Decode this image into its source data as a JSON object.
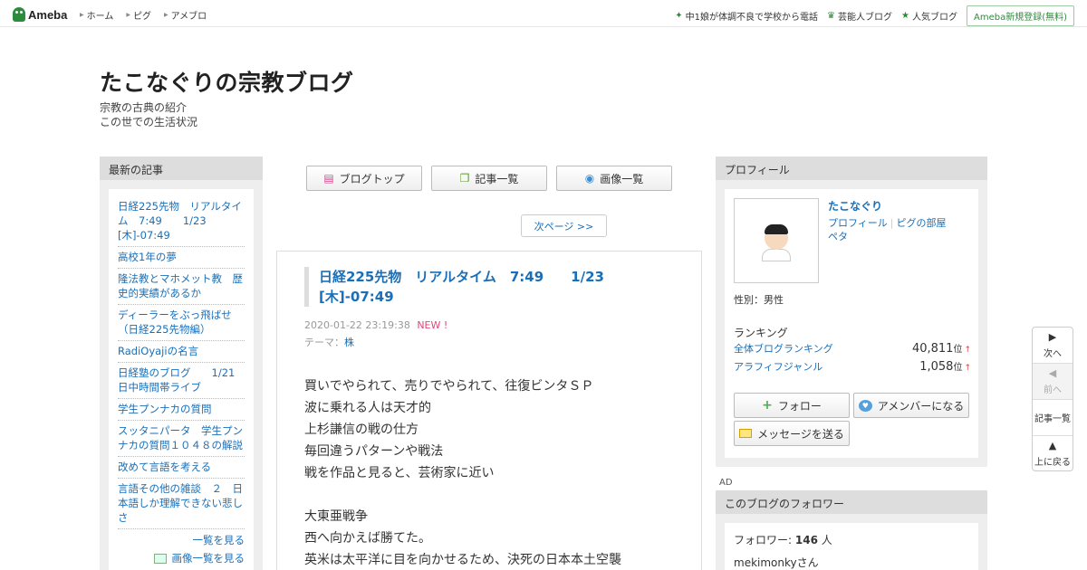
{
  "topbar": {
    "logo": "Ameba",
    "nav": [
      "ホーム",
      "ピグ",
      "アメブロ"
    ],
    "right_links": [
      {
        "icon": "sparkle-icon",
        "label": "中1娘が体調不良で学校から電話"
      },
      {
        "icon": "crown-icon",
        "label": "芸能人ブログ"
      },
      {
        "icon": "star-icon",
        "label": "人気ブログ"
      }
    ],
    "signup": "Ameba新規登録(無料)"
  },
  "header": {
    "title": "たこなぐりの宗教ブログ",
    "desc_line1": "宗教の古典の紹介",
    "desc_line2": "この世での生活状況"
  },
  "recent": {
    "heading": "最新の記事",
    "items": [
      "日経225先物　リアルタイム　7:49　　1/23 [木]-07:49",
      "高校1年の夢",
      "隆法教とマホメット教　歴史的実績があるか",
      "ディーラーをぶっ飛ばせ（日経225先物編）",
      "RadiOyajiの名言",
      "日経塾のブログ　　1/21 日中時間帯ライブ",
      "学生プンナカの質問",
      "スッタニパータ　学生プンナカの質問１０４８の解説",
      "改めて言語を考える",
      "言語その他の雑談　２　日本語しか理解できない悲しさ"
    ],
    "more": "一覧を見る",
    "img_more": "画像一覧を見る"
  },
  "tabs": {
    "blog_top": "ブログトップ",
    "entries": "記事一覧",
    "images": "画像一覧"
  },
  "next_page": "次ページ >>",
  "article": {
    "title": "日経225先物　リアルタイム　7:49　　1/23 [木]-07:49",
    "date": "2020-01-22 23:19:38",
    "new_badge": "NEW !",
    "theme_label": "テーマ：",
    "theme": "株",
    "body": [
      "買いでやられて、売りでやられて、往復ビンタＳＰ",
      "波に乗れる人は天才的",
      "上杉謙信の戦の仕方",
      "毎回違うパターンや戦法",
      "戦を作品と見ると、芸術家に近い",
      "",
      "大東亜戦争",
      "西へ向かえば勝てた。",
      "英米は太平洋に目を向かせるため、決死の日本本土空襲"
    ]
  },
  "profile": {
    "heading": "プロフィール",
    "name": "たこなぐり",
    "link_profile": "プロフィール",
    "link_pig": "ピグの部屋",
    "link_peta": "ペタ",
    "gender": "性別：男性",
    "ranking_label": "ランキング",
    "rank_all_label": "全体ブログランキング",
    "rank_all_value": "40,811",
    "rank_genre_label": "アラフィフジャンル",
    "rank_genre_value": "1,058",
    "rank_unit": "位",
    "rank_up": "↑",
    "follow": "フォロー",
    "amember": "アメンバーになる",
    "message": "メッセージを送る"
  },
  "ad_label": "AD",
  "followers": {
    "heading": "このブログのフォロワー",
    "count_label": "フォロワー:",
    "count": "146",
    "count_unit": "人",
    "first_user": "mekimonkyさん"
  },
  "floatnav": {
    "next": "次へ",
    "prev": "前へ",
    "entries": "記事一覧",
    "top": "上に戻る"
  }
}
